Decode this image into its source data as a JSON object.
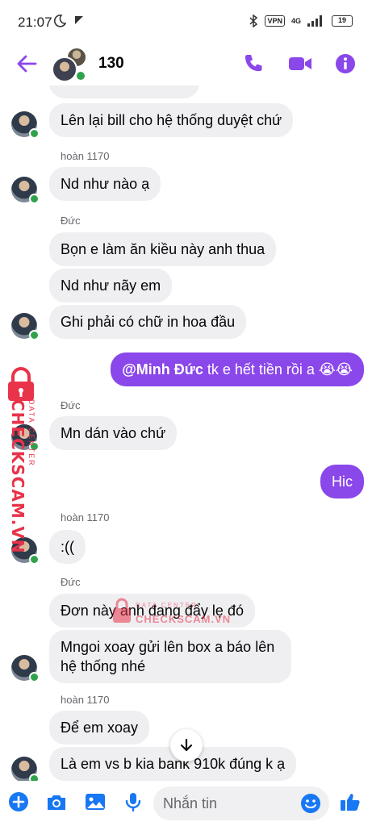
{
  "status_bar": {
    "time": "21:07",
    "vpn": "VPN",
    "network": "4G",
    "battery": "19"
  },
  "header": {
    "title": "130"
  },
  "colors": {
    "accent": "#8a47ea",
    "online": "#31a24c",
    "bubble_grey": "#efeff2",
    "watermark": "#e8334a"
  },
  "messages": [
    {
      "type": "in",
      "text": "Lên lại bill cho hệ thống duyệt chứ"
    },
    {
      "type": "sender",
      "text": "hoàn 1170"
    },
    {
      "type": "in",
      "text": "Nd như nào ạ"
    },
    {
      "type": "sender",
      "text": "Đức"
    },
    {
      "type": "in",
      "text": "Bọn e làm ăn kiều này anh thua"
    },
    {
      "type": "in",
      "text": "Nd như nãy em"
    },
    {
      "type": "in",
      "text": "Ghi phải có chữ in hoa đầu"
    },
    {
      "type": "out",
      "mention": "@Minh Đức",
      "text": " tk e hết tiền rồi a 😭😭"
    },
    {
      "type": "sender",
      "text": "Đức"
    },
    {
      "type": "in",
      "text": "Mn dán vào chứ"
    },
    {
      "type": "out",
      "text": "Hic"
    },
    {
      "type": "sender",
      "text": "hoàn 1170"
    },
    {
      "type": "in",
      "text": ":(("
    },
    {
      "type": "sender",
      "text": "Đức"
    },
    {
      "type": "in",
      "text": "Đơn này anh đang đẩy lẹ đó"
    },
    {
      "type": "in",
      "text": "Mngoi xoay gửi lên box a báo lên hệ thống nhé"
    },
    {
      "type": "sender",
      "text": "hoàn 1170"
    },
    {
      "type": "in",
      "text": "Để em xoay"
    },
    {
      "type": "in",
      "text": "Là em vs b kia bank 910k đúng k ạ"
    }
  ],
  "watermark": {
    "brand": "CHECKSCAM.VN",
    "subtitle": "DATA CENTER"
  },
  "composer": {
    "placeholder": "Nhắn tin"
  },
  "icons": [
    "back-arrow-icon",
    "phone-icon",
    "video-icon",
    "info-icon",
    "plus-icon",
    "camera-icon",
    "image-icon",
    "mic-icon",
    "emoji-icon",
    "like-icon",
    "chevron-down-icon"
  ]
}
